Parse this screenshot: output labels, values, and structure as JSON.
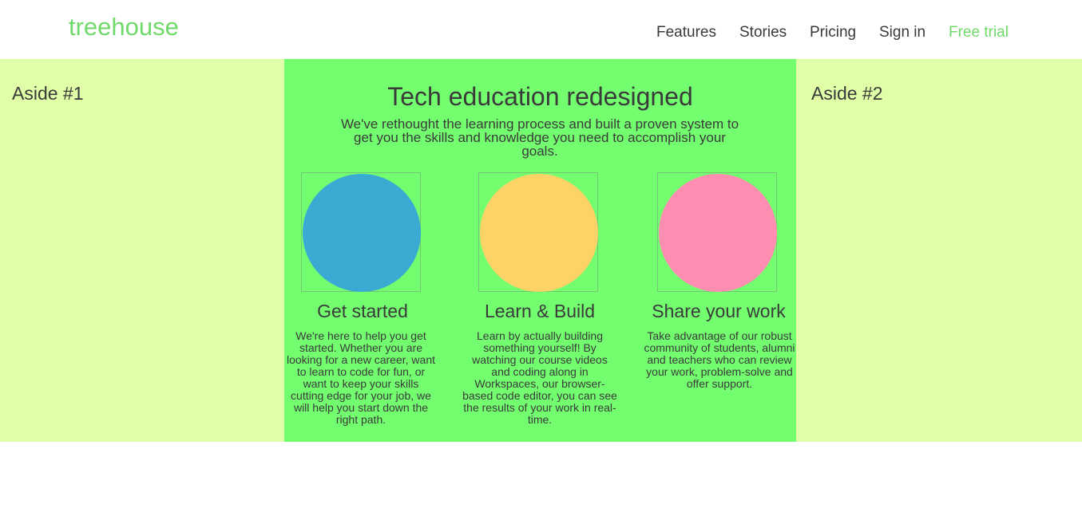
{
  "header": {
    "logo": "treehouse",
    "nav": {
      "features": "Features",
      "stories": "Stories",
      "pricing": "Pricing",
      "signin": "Sign in",
      "free_trial": "Free trial"
    }
  },
  "aside1": {
    "title": "Aside #1"
  },
  "aside2": {
    "title": "Aside #2"
  },
  "main": {
    "title": "Tech education redesigned",
    "subtitle": "We've rethought the learning process and built a proven system to get you the skills and knowledge you need to accomplish your goals.",
    "features": [
      {
        "title": "Get started",
        "text": "We're here to help you get started. Whether you are looking for a new career, want to learn to code for fun, or want to keep your skills cutting edge for your job, we will help you start down the right path.",
        "color": "#39abd3"
      },
      {
        "title": "Learn & Build",
        "text": "Learn by actually building something yourself! By watching our course videos and coding along in Workspaces, our browser-based code editor, you can see the results of your work in real-time.",
        "color": "#fdd266"
      },
      {
        "title": "Share your work",
        "text": "Take advantage of our robust community of students, alumni and teachers who can review your work, problem-solve and offer support.",
        "color": "#fe8db1"
      }
    ]
  },
  "colors": {
    "brand": "#6fd96a",
    "main_bg": "#73fe6f",
    "aside_bg": "#dffea7"
  }
}
